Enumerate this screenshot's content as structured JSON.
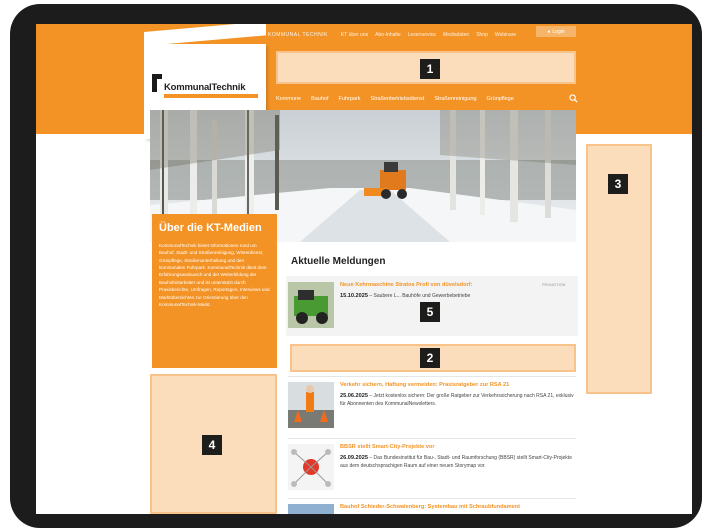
{
  "header": {
    "brand_small": "KOMMUNAL TECHNIK",
    "topnav": [
      "KT über uns",
      "Abo-Inhalte",
      "Leserservice",
      "Mediadaten",
      "Shop",
      "Webinare"
    ],
    "login_label": "Login"
  },
  "logo": {
    "name": "KommunalTechnik"
  },
  "mainnav": [
    "Kommune",
    "Bauhof",
    "Fuhrpark",
    "Straßenbetriebsdienst",
    "Straßenreinigung",
    "Grünpflege"
  ],
  "about": {
    "title": "Über die KT-Medien",
    "text": "KommunalTechnik bietet Informationen rund um Bauhof, Stadt- und Straßenreinigung, Winterdienst, Grünpflege, Straßenunterhaltung und den kommunalen Fuhrpark. KommunalTechnik dient dem Erfahrungsaustausch und der Weiterbildung der Bauhofmitarbeiter und ist unterstützt durch Praxisberichte, Umfragen, Reportagen, Interviews und Marktübersichten zur Orientierung über den KommunalTechnik-Markt."
  },
  "news": {
    "section_title": "Aktuelle Meldungen",
    "promo_tag": "PROMOTION",
    "items": [
      {
        "title": "Neue Kehrmaschine Stratos Profi von düvelsdorf:",
        "date": "15.10.2025",
        "text": "– Saubere L... Bauhöfe und Gewerbebetriebe"
      },
      {
        "title": "Verkehr sichern, Haftung vermeiden: Praxisratgeber zur RSA 21",
        "date": "25.06.2025",
        "text": "– Jetzt kostenlos sichern: Der große Ratgeber zur Verkehrssicherung nach RSA 21, exklusiv für Abonnenten des KommunalNewsletters."
      },
      {
        "title": "BBSR stellt Smart-City-Projekte vor",
        "date": "26.09.2025",
        "text": "– Das Bundesinstitut für Bau-, Stadt- und Raumforschung (BBSR) stellt Smart-City-Projekte aus dem deutschsprachigen Raum auf einer neuen Storymap vor."
      },
      {
        "title": "Bauhof Schieder-Schwalenberg: Systembau mit Schraubfundament",
        "date": "",
        "text": ""
      }
    ]
  },
  "badges": [
    "1",
    "2",
    "3",
    "4",
    "5"
  ],
  "colors": {
    "accent": "#f39325",
    "slot_fill": "#fbdcbb",
    "badge": "#1d1d1b"
  }
}
